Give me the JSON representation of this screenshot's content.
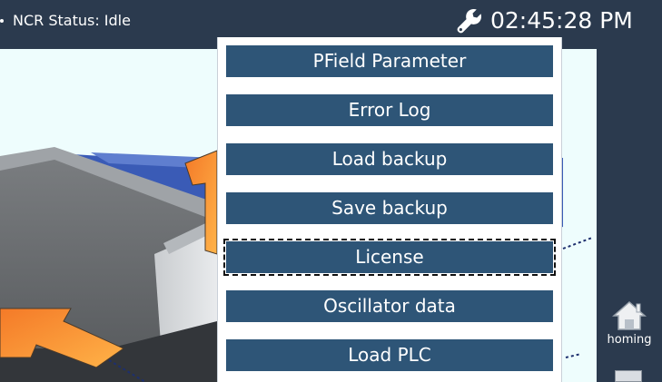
{
  "status_bar": {
    "status_text": "NCR Status: Idle",
    "settings_icon": "wrench-icon",
    "clock": "02:45:28 PM"
  },
  "menu": {
    "items": [
      {
        "label": "PField Parameter"
      },
      {
        "label": "Error Log"
      },
      {
        "label": "Load backup"
      },
      {
        "label": "Save backup"
      },
      {
        "label": "License",
        "focused": true
      },
      {
        "label": "Oscillator data"
      },
      {
        "label": "Load PLC"
      }
    ]
  },
  "side_panel": {
    "homing_label": "homing",
    "homing_icon": "home-icon"
  },
  "colors": {
    "chrome": "#2b3a4e",
    "menu_button": "#2e5577",
    "canvas_background": "#eefdfd",
    "arrow_orange": "#f47c2a"
  }
}
